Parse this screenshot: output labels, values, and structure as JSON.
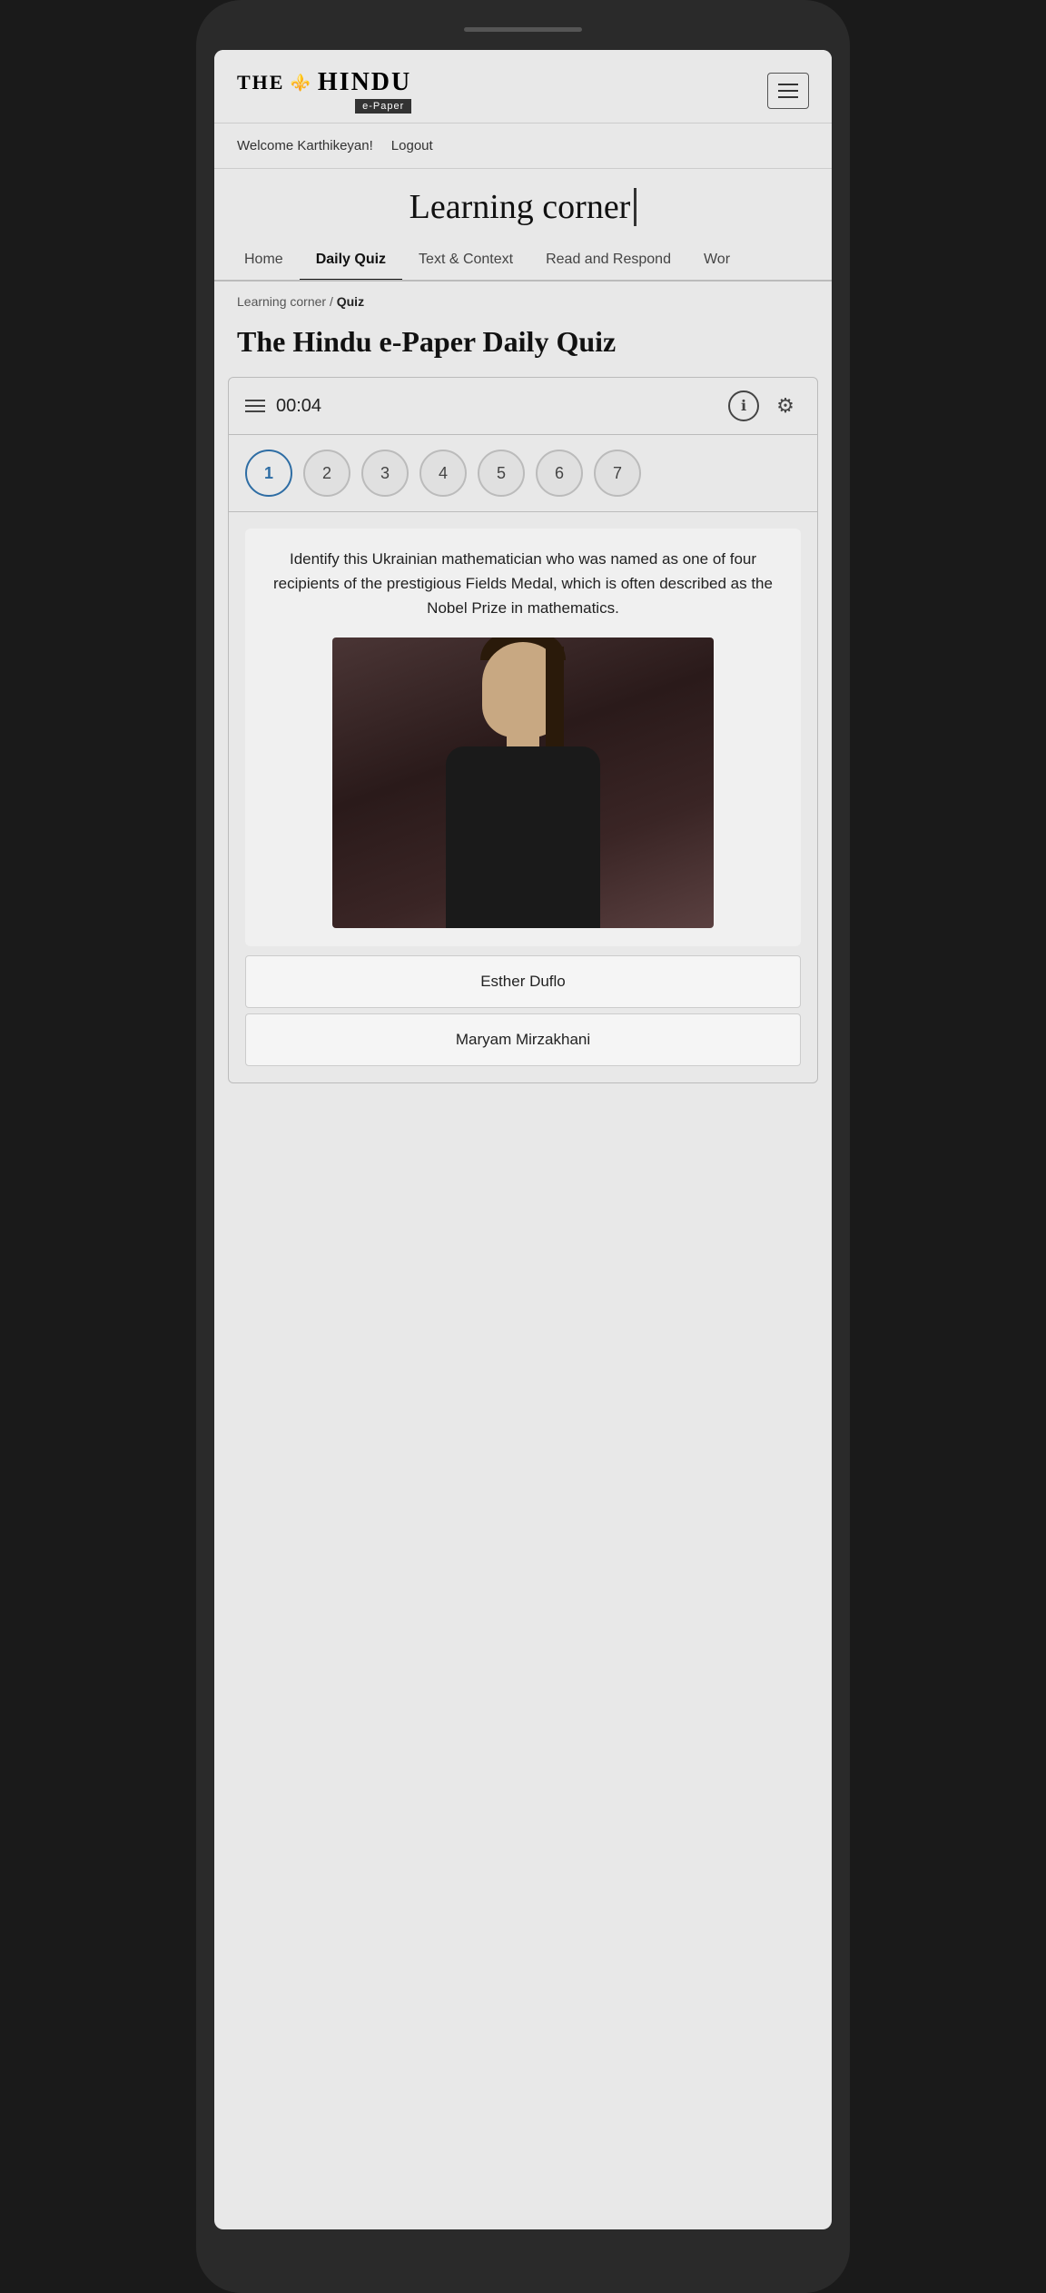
{
  "device": {
    "notch": true
  },
  "header": {
    "logo_the": "THE",
    "logo_emblem": "🦁",
    "logo_hindu": "HINDU",
    "epaper_label": "e-Paper",
    "hamburger_label": "menu"
  },
  "welcome": {
    "text": "Welcome Karthikeyan!",
    "logout": "Logout"
  },
  "learning_corner": {
    "title": "Learning corner"
  },
  "nav": {
    "tabs": [
      {
        "label": "Home",
        "active": false
      },
      {
        "label": "Daily Quiz",
        "active": true
      },
      {
        "label": "Text & Context",
        "active": false
      },
      {
        "label": "Read and Respond",
        "active": false
      },
      {
        "label": "Wor",
        "active": false
      }
    ]
  },
  "breadcrumb": {
    "parent": "Learning corner",
    "separator": "/",
    "current": "Quiz"
  },
  "page_title": "The Hindu e-Paper Daily Quiz",
  "quiz": {
    "timer": "00:04",
    "question_numbers": [
      1,
      2,
      3,
      4,
      5,
      6,
      7
    ],
    "active_question": 1,
    "question_text": "Identify this Ukrainian mathematician who was named as one of four recipients of the prestigious Fields Medal, which is often described as the Nobel Prize in mathematics.",
    "answers": [
      {
        "label": "Esther Duflo"
      },
      {
        "label": "Maryam Mirzakhani"
      }
    ]
  }
}
